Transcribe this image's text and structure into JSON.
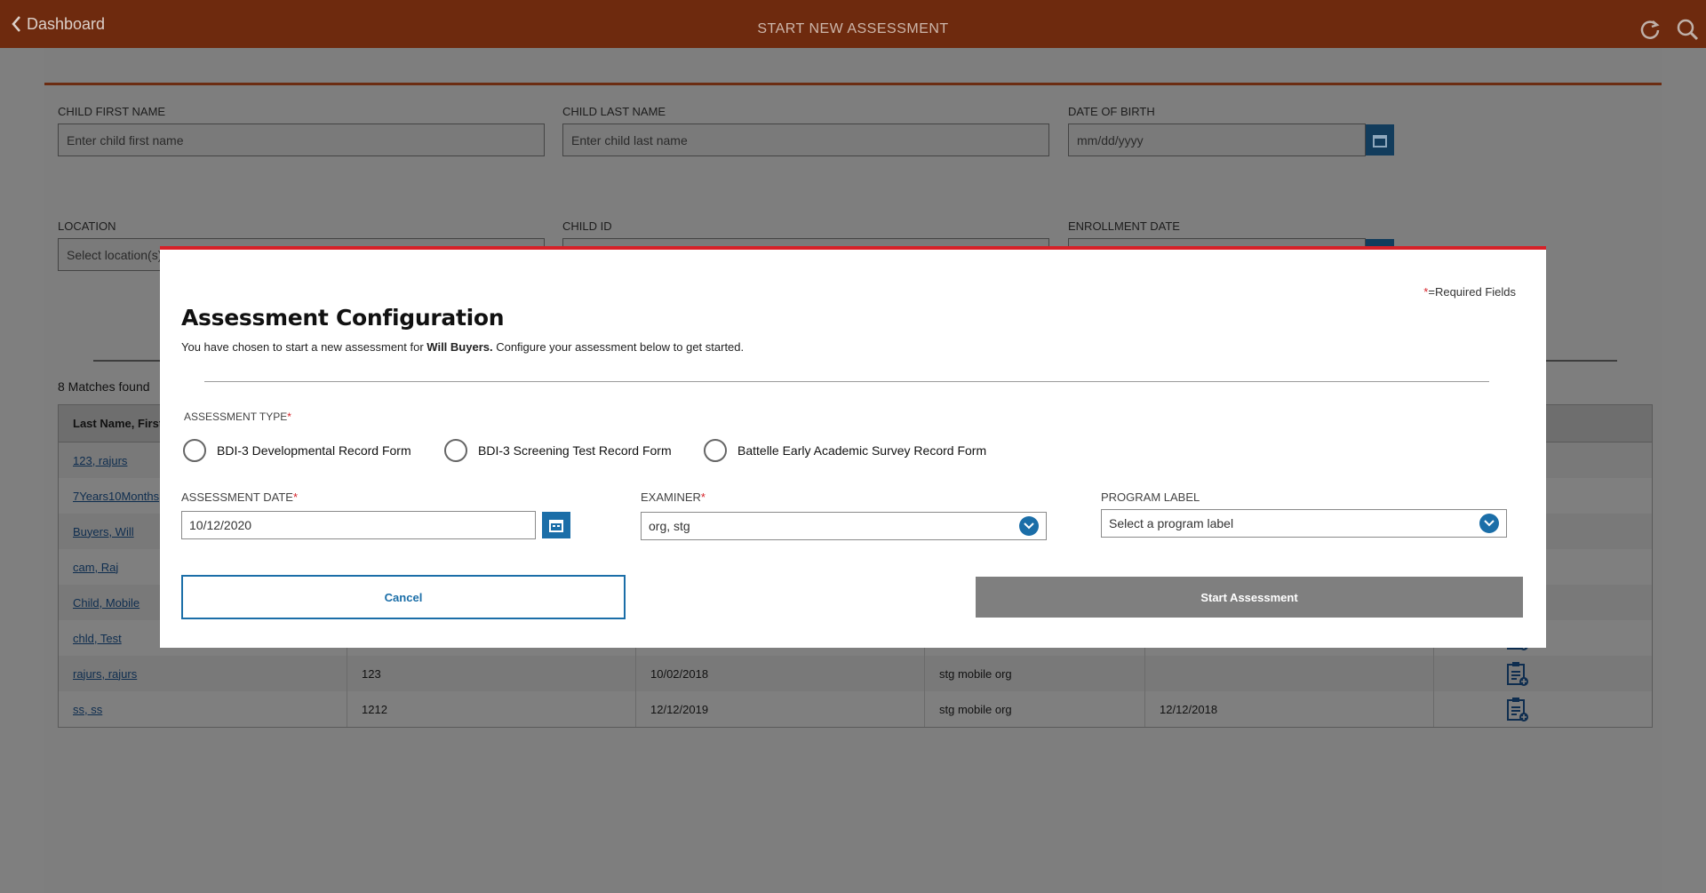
{
  "topbar": {
    "back_label": "Dashboard",
    "title": "START NEW ASSESSMENT"
  },
  "form": {
    "first_name_label": "CHILD FIRST NAME",
    "first_name_placeholder": "Enter child first name",
    "last_name_label": "CHILD LAST NAME",
    "last_name_placeholder": "Enter child last name",
    "dob_label": "DATE OF BIRTH",
    "dob_placeholder": "mm/dd/yyyy",
    "location_label": "LOCATION",
    "location_placeholder": "Select location(s)",
    "child_id_label": "CHILD ID",
    "enrollment_label": "ENROLLMENT DATE"
  },
  "results": {
    "matches_text": "8 Matches found",
    "header_first_col": "Last Name, First",
    "rows": [
      {
        "name": "123, rajurs",
        "id": "",
        "dob": "",
        "org": "",
        "enroll": ""
      },
      {
        "name": "7Years10Months",
        "id": "",
        "dob": "",
        "org": "",
        "enroll": ""
      },
      {
        "name": "Buyers, Will",
        "id": "",
        "dob": "",
        "org": "",
        "enroll": ""
      },
      {
        "name": "cam, Raj",
        "id": "",
        "dob": "",
        "org": "",
        "enroll": ""
      },
      {
        "name": "Child, Mobile",
        "id": "",
        "dob": "",
        "org": "",
        "enroll": ""
      },
      {
        "name": "chld, Test",
        "id": "",
        "dob": "",
        "org": "",
        "enroll": ""
      },
      {
        "name": "rajurs, rajurs",
        "id": "123",
        "dob": "10/02/2018",
        "org": "stg mobile org",
        "enroll": ""
      },
      {
        "name": "ss, ss",
        "id": "1212",
        "dob": "12/12/2019",
        "org": "stg mobile org",
        "enroll": "12/12/2018"
      }
    ]
  },
  "modal": {
    "required_star": "*",
    "required_text": "=Required Fields",
    "title": "Assessment Configuration",
    "subtitle_pre": "You have chosen to start a new assessment for ",
    "subtitle_name": "Will  Buyers.",
    "subtitle_post": " Configure your assessment below to get started.",
    "assessment_type_label": "ASSESSMENT TYPE",
    "types": [
      "BDI-3 Developmental Record Form",
      "BDI-3 Screening Test Record Form",
      "Battelle Early Academic Survey Record Form"
    ],
    "date_label": "ASSESSMENT DATE",
    "date_value": "10/12/2020",
    "examiner_label": "EXAMINER",
    "examiner_value": "org, stg",
    "program_label": "PROGRAM LABEL",
    "program_placeholder": "Select a program label",
    "cancel_label": "Cancel",
    "start_label": "Start Assessment"
  },
  "colors": {
    "accent": "#1b6ea8",
    "topbar": "#6e2a0e",
    "required": "#d62128"
  }
}
